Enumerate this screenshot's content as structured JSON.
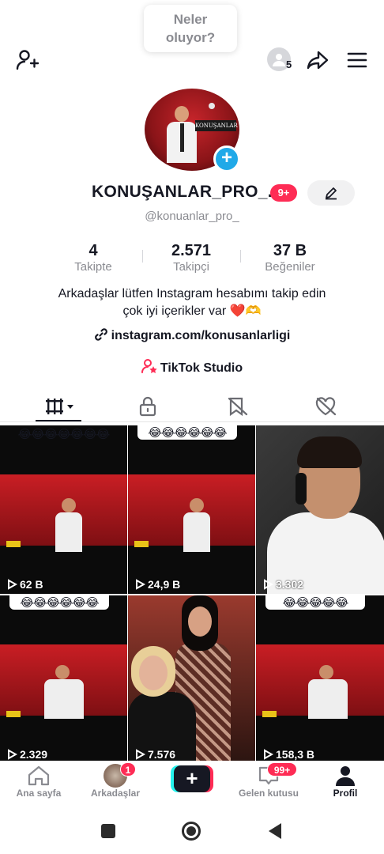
{
  "header": {
    "status_bubble_line1": "Neler",
    "status_bubble_line2": "oluyor?",
    "friends_count": "5"
  },
  "profile": {
    "display_name": "KONUŞANLAR_PRO_...",
    "notification_badge": "9+",
    "username": "@konuanlar_pro_",
    "avatar_banner": "KONUŞANLAR",
    "stats": [
      {
        "value": "4",
        "label": "Takipte"
      },
      {
        "value": "2.571",
        "label": "Takipçi"
      },
      {
        "value": "37 B",
        "label": "Beğeniler"
      }
    ],
    "bio_line1": "Arkadaşlar lütfen Instagram hesabımı takip edin",
    "bio_line2": "çok iyi içerikler var ❤️🫶",
    "link": "instagram.com/konusanlarligi",
    "studio": "TikTok Studio"
  },
  "videos": [
    {
      "views": "62 B",
      "caption": "😂😂😂😂😂😂😂"
    },
    {
      "views": "24,9 B",
      "caption": "😂😂😂😂😂😂"
    },
    {
      "views": "3.302",
      "caption": ""
    },
    {
      "views": "2.329",
      "caption": "😂😂😂😂😂😂"
    },
    {
      "views": "7.576",
      "caption": ""
    },
    {
      "views": "158,3 B",
      "caption": "😂😂😂😂😂"
    }
  ],
  "bottom_nav": {
    "home": "Ana sayfa",
    "friends": "Arkadaşlar",
    "friends_badge": "1",
    "inbox": "Gelen kutusu",
    "inbox_badge": "99+",
    "profile": "Profil",
    "create": "+"
  },
  "colors": {
    "accent": "#fe2c55",
    "blue": "#20a9e8",
    "text": "#161823",
    "muted": "#8a8b91"
  }
}
